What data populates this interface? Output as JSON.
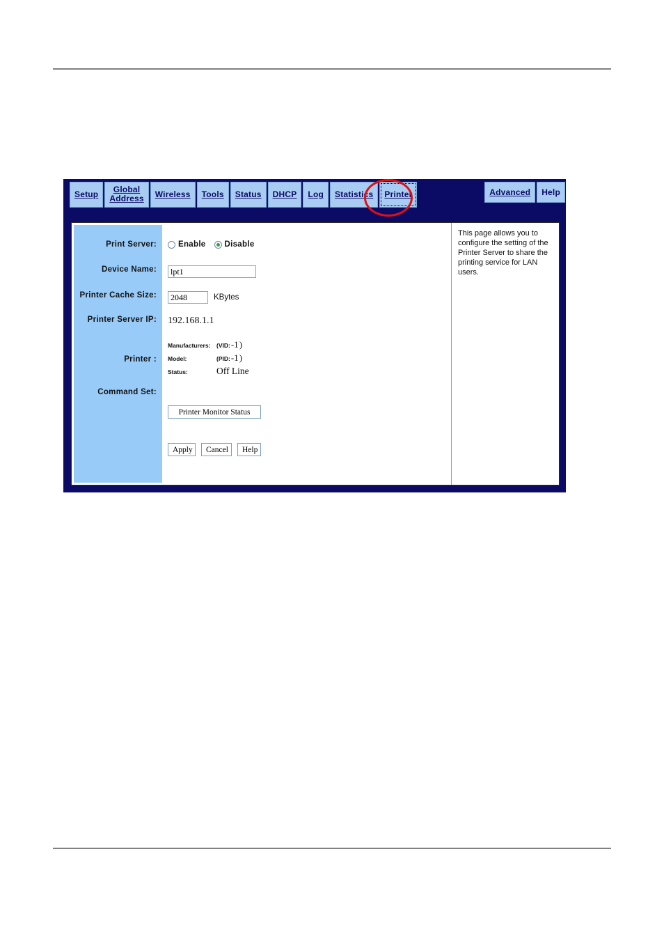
{
  "nav": {
    "left_tabs": [
      {
        "label": "Setup",
        "underlined": true,
        "focused": false,
        "two_line": false
      },
      {
        "label": "Global\nAddress",
        "underlined": true,
        "focused": false,
        "two_line": true
      },
      {
        "label": "Wireless",
        "underlined": true,
        "focused": false,
        "two_line": false
      },
      {
        "label": "Tools",
        "underlined": true,
        "focused": false,
        "two_line": false
      },
      {
        "label": "Status",
        "underlined": true,
        "focused": false,
        "two_line": false
      },
      {
        "label": "DHCP",
        "underlined": true,
        "focused": false,
        "two_line": false
      },
      {
        "label": "Log",
        "underlined": true,
        "focused": false,
        "two_line": false
      },
      {
        "label": "Statistics",
        "underlined": true,
        "focused": false,
        "two_line": false
      },
      {
        "label": "Printer",
        "underlined": true,
        "focused": true,
        "two_line": false
      }
    ],
    "right_tabs": [
      {
        "label": "Advanced",
        "underlined": true,
        "focused": false,
        "two_line": false
      },
      {
        "label": "Help",
        "underlined": false,
        "focused": false,
        "two_line": false
      }
    ],
    "bar_color": "#0b0b66",
    "tab_color": "#a9cdf2",
    "highlight_color": "#e01010"
  },
  "form": {
    "print_server": {
      "label": "Print Server:",
      "options": [
        {
          "label": "Enable",
          "selected": false
        },
        {
          "label": "Disable",
          "selected": true
        }
      ]
    },
    "device_name": {
      "label": "Device Name:",
      "value": "lpt1"
    },
    "printer_cache_size": {
      "label": "Printer Cache Size:",
      "value": "2048",
      "unit": "KBytes"
    },
    "printer_server_ip": {
      "label": "Printer Server IP:",
      "value": "192.168.1.1"
    },
    "printer": {
      "label": "Printer :",
      "manufacturers_key": "Manufacturers:",
      "manufacturers_value": "",
      "vid_text": "(VID:",
      "vid_value": "-1",
      "vid_close": ")",
      "model_key": "Model:",
      "model_value": "",
      "pid_text": "(PID:",
      "pid_value": "-1",
      "pid_close": ")",
      "status_key": "Status:",
      "status_value": "Off Line"
    },
    "command_set": {
      "label": "Command Set:",
      "value": ""
    },
    "printer_monitor_button": "Printer Monitor Status",
    "apply_button": "Apply",
    "cancel_button": "Cancel",
    "help_button": "Help"
  },
  "help_panel": {
    "text": "This page allows you to configure the setting of the Printer Server to share the printing service for LAN users."
  }
}
